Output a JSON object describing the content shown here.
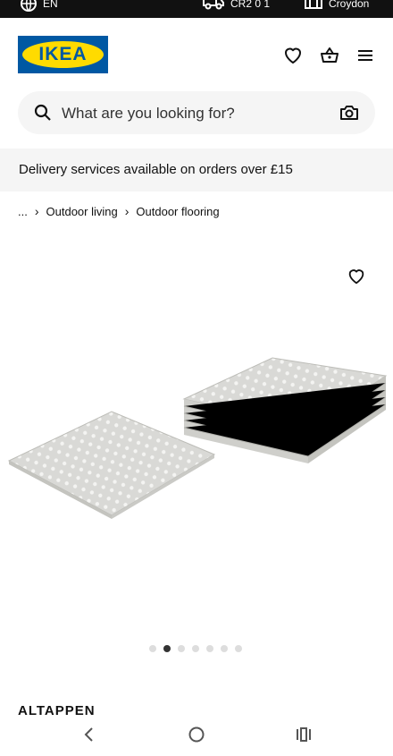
{
  "status_bar": {
    "left_label": "EN",
    "mid_label": "CR2 0 1",
    "right_label": "Croydon"
  },
  "brand": {
    "logo_text": "IKEA",
    "blue": "#0058a3",
    "yellow": "#ffdb00"
  },
  "search": {
    "placeholder": "What are you looking for?"
  },
  "banner": {
    "text": "Delivery services available on orders over £15"
  },
  "breadcrumb": {
    "ellipsis": "...",
    "items": [
      "Outdoor living",
      "Outdoor flooring"
    ]
  },
  "gallery": {
    "image_count": 7,
    "active_index": 1
  },
  "product": {
    "name": "ALTAPPEN"
  },
  "icons": {
    "header": [
      "heart-icon",
      "basket-icon",
      "menu-icon"
    ],
    "search": [
      "search-icon",
      "camera-icon"
    ],
    "nav": [
      "back-icon",
      "home-icon",
      "recents-icon"
    ]
  }
}
